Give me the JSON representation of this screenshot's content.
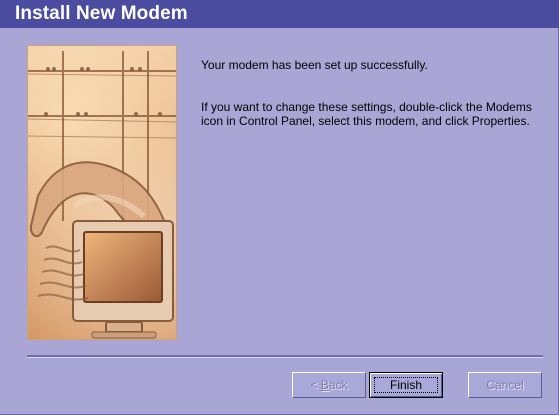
{
  "window": {
    "title": "Install New Modem"
  },
  "content": {
    "message_1": "Your modem has been set up successfully.",
    "message_2": "If you want to change these settings, double-click the Modems icon in Control Panel, select this modem, and click Properties."
  },
  "buttons": {
    "back": {
      "mnemonic": "B",
      "rest": "ack",
      "prefix": "< ",
      "state": "disabled"
    },
    "finish": {
      "label": "Finish",
      "state": "default"
    },
    "cancel": {
      "label": "Cancel",
      "state": "disabled"
    }
  },
  "colors": {
    "titlebar": "#4b4c9f",
    "dialog_bg": "#a9a6d6",
    "title_text": "#ffffff"
  }
}
